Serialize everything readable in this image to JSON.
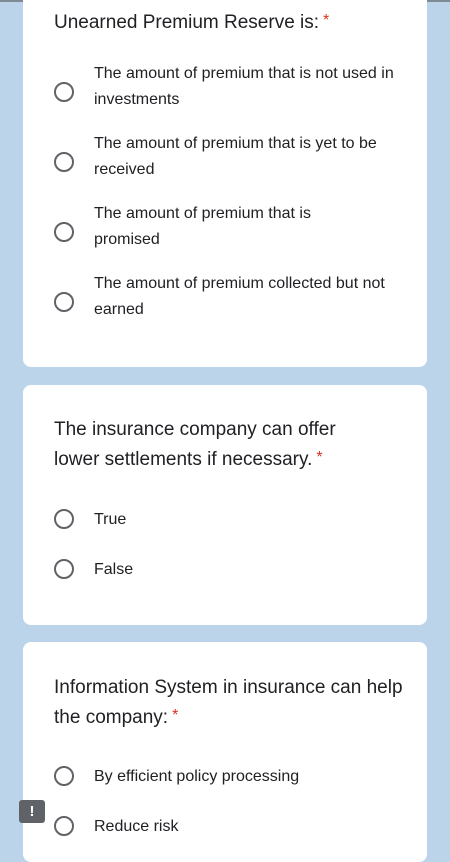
{
  "questions": [
    {
      "title": "Unearned Premium Reserve is:",
      "required_mark": "*",
      "options": [
        "The amount of premium that is not used in investments",
        "The amount of premium that is yet to be received",
        "The amount of premium that is promised",
        "The amount of premium collected but not earned"
      ]
    },
    {
      "title": "The insurance company can offer lower settlements if necessary.",
      "required_mark": "*",
      "options": [
        "True",
        "False"
      ]
    },
    {
      "title": "Information System in insurance can help the company:",
      "required_mark": "*",
      "options": [
        "By efficient policy processing",
        "Reduce risk"
      ]
    }
  ],
  "report_button": {
    "label": "!"
  },
  "colors": {
    "page_background": "#bcd4ea",
    "card_background": "#ffffff",
    "required_asterisk": "#d93025",
    "radio_border": "#5f6368"
  }
}
